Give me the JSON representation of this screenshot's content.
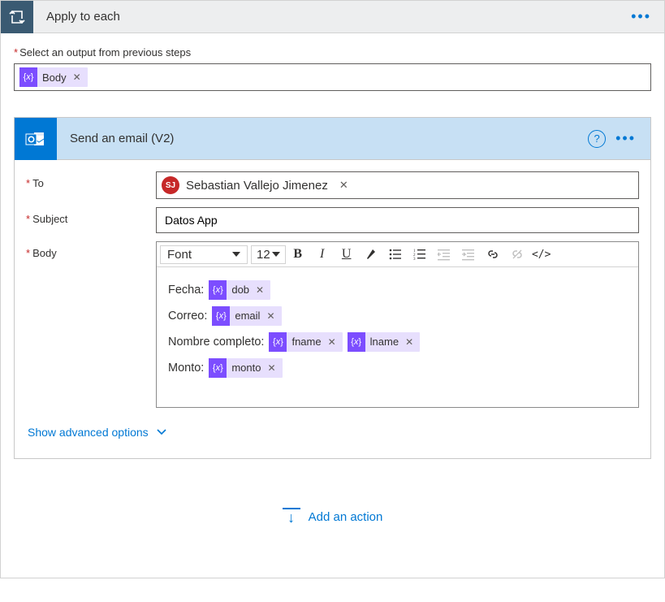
{
  "outer": {
    "title": "Apply to each",
    "output_label": "Select an output from previous steps",
    "output_token": "Body"
  },
  "email": {
    "title": "Send an email (V2)",
    "labels": {
      "to": "To",
      "subject": "Subject",
      "body": "Body"
    },
    "to": {
      "initials": "SJ",
      "name": "Sebastian Vallejo Jimenez"
    },
    "subject": "Datos App",
    "toolbar": {
      "font": "Font",
      "size": "12"
    },
    "body_lines": [
      {
        "prefix": "Fecha:",
        "tokens": [
          "dob"
        ]
      },
      {
        "prefix": "Correo:",
        "tokens": [
          "email"
        ]
      },
      {
        "prefix": "Nombre completo:",
        "tokens": [
          "fname",
          "lname"
        ]
      },
      {
        "prefix": "Monto:",
        "tokens": [
          "monto"
        ]
      }
    ],
    "advanced": "Show advanced options"
  },
  "add_action": "Add an action"
}
